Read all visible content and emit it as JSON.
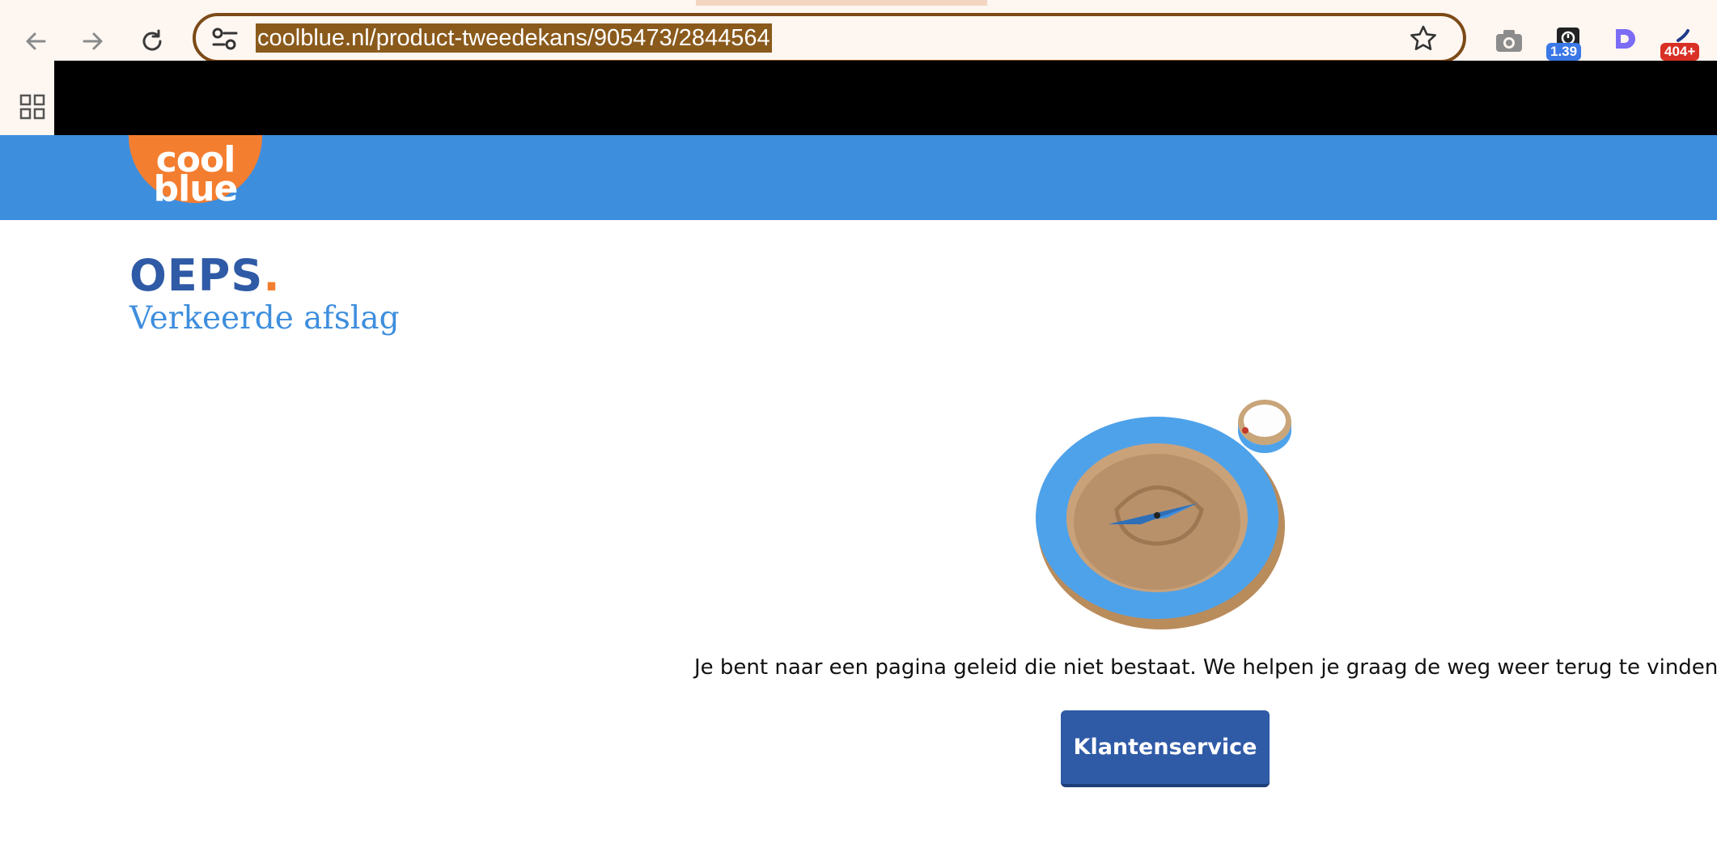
{
  "browser": {
    "url": "coolblue.nl/product-tweedekans/905473/2844564",
    "back_icon": "arrow-left-icon",
    "forward_icon": "arrow-right-icon",
    "reload_icon": "reload-icon",
    "site_settings_icon": "tune-icon",
    "bookmark_icon": "star-icon",
    "extensions": [
      {
        "name": "camera-icon"
      },
      {
        "name": "timer-extension-icon",
        "badge": "1.39",
        "badge_color": "#3b78e7"
      },
      {
        "name": "d-extension-icon"
      },
      {
        "name": "error-extension-icon",
        "badge": "404+",
        "badge_color": "#d93025"
      }
    ],
    "apps_icon": "apps-grid-icon"
  },
  "site": {
    "logo_line1": "cool",
    "logo_line2": "blue",
    "header_color": "#3e8ede",
    "logo_color": "#f47e30"
  },
  "page": {
    "heading": "OEPS",
    "heading_dot": ".",
    "subtitle": "Verkeerde afslag",
    "message": "Je bent naar een pagina geleid die niet bestaat. We helpen je graag de weg weer terug te vinden.",
    "button_label": "Klantenservice",
    "illustration": "cardboard-compass-illustration"
  }
}
